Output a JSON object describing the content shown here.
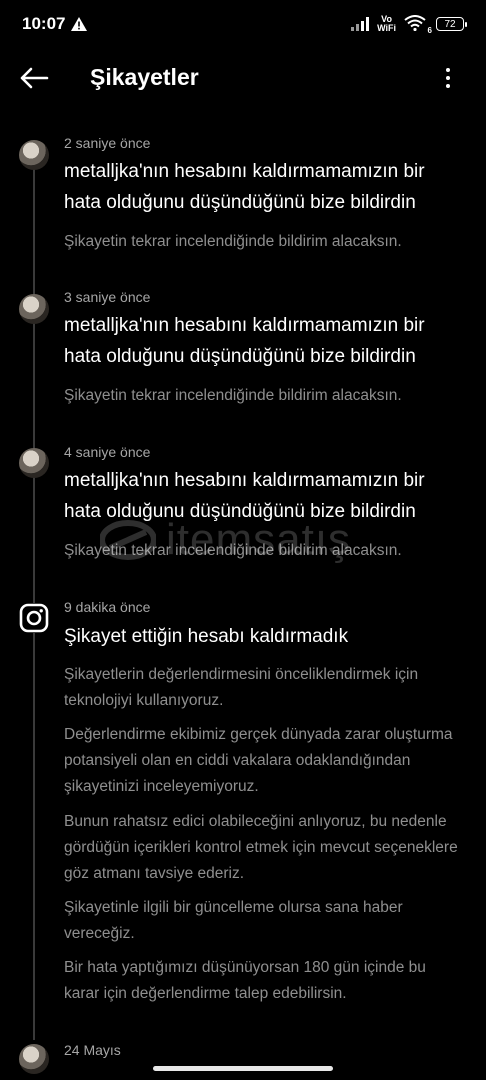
{
  "status_bar": {
    "time": "10:07",
    "alert_icon": "warning-triangle-icon",
    "vowifi_top": "Vo",
    "vowifi_bottom": "WiFi",
    "wifi_badge": "6",
    "battery": "72"
  },
  "header": {
    "title": "Şikayetler",
    "back_icon": "arrow-left-icon",
    "menu_icon": "more-vertical-icon"
  },
  "items": [
    {
      "time": "2 saniye önce",
      "headline": "metalljka'nın hesabını kaldırmamamızın bir hata olduğunu düşündüğünü bize bildirdin",
      "sub": "Şikayetin tekrar incelendiğinde bildirim alacaksın."
    },
    {
      "time": "3 saniye önce",
      "headline": "metalljka'nın hesabını kaldırmamamızın bir hata olduğunu düşündüğünü bize bildirdin",
      "sub": "Şikayetin tekrar incelendiğinde bildirim alacaksın."
    },
    {
      "time": "4 saniye önce",
      "headline": "metalljka'nın hesabını kaldırmamamızın bir hata olduğunu düşündüğünü bize bildirdin",
      "sub": "Şikayetin tekrar incelendiğinde bildirim alacaksın."
    },
    {
      "time": "9 dakika önce",
      "headline": "Şikayet ettiğin hesabı kaldırmadık",
      "paragraphs": [
        "Şikayetlerin değerlendirmesini önceliklendirmek için teknolojiyi kullanıyoruz.",
        "Değerlendirme ekibimiz gerçek dünyada zarar oluşturma potansiyeli olan en ciddi vakalara odaklandığından şikayetinizi inceleyemiyoruz.",
        "Bunun rahatsız edici olabileceğini anlıyoruz, bu nedenle gördüğün içerikleri kontrol etmek için mevcut seçeneklere göz atmanı tavsiye ederiz.",
        "Şikayetinle ilgili bir güncelleme olursa sana haber vereceğiz.",
        "Bir hata yaptığımızı düşünüyorsan 180 gün içinde bu karar için değerlendirme talep edebilirsin."
      ]
    },
    {
      "time": "24 Mayıs"
    }
  ],
  "watermark": "itemsatış"
}
